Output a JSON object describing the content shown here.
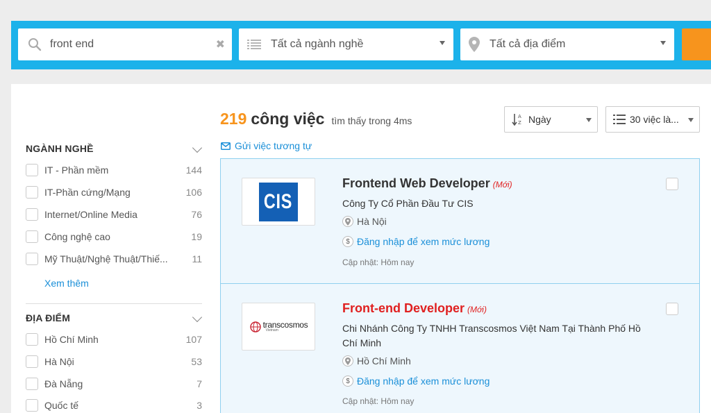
{
  "search": {
    "keyword": "front end",
    "industry": "Tất cả ngành nghề",
    "location": "Tất cả địa điểm"
  },
  "results": {
    "count": "219",
    "count_label": "công việc",
    "time_text": "tìm thấy trong 4ms",
    "subscribe": "Gửi việc tương tự",
    "sort_label": "Ngày",
    "per_page_label": "30 việc là..."
  },
  "filters": {
    "industry": {
      "heading": "NGÀNH NGHỀ",
      "items": [
        {
          "label": "IT - Phần mềm",
          "count": "144"
        },
        {
          "label": "IT-Phần cứng/Mạng",
          "count": "106"
        },
        {
          "label": "Internet/Online Media",
          "count": "76"
        },
        {
          "label": "Công nghệ cao",
          "count": "19"
        },
        {
          "label": "Mỹ Thuật/Nghệ Thuật/Thiế...",
          "count": "11"
        }
      ],
      "more": "Xem thêm"
    },
    "location": {
      "heading": "ĐỊA ĐIỂM",
      "items": [
        {
          "label": "Hồ Chí Minh",
          "count": "107"
        },
        {
          "label": "Hà Nội",
          "count": "53"
        },
        {
          "label": "Đà Nẵng",
          "count": "7"
        },
        {
          "label": "Quốc tế",
          "count": "3"
        }
      ]
    }
  },
  "jobs": [
    {
      "title": "Frontend Web Developer",
      "new_tag": "(Mới)",
      "company": "Công Ty Cổ Phần Đầu Tư CIS",
      "location": "Hà Nội",
      "salary": "Đăng nhập để xem mức lương",
      "updated": "Cập nhật: Hôm nay",
      "logo_text": "CIS"
    },
    {
      "title": "Front-end Developer",
      "new_tag": "(Mới)",
      "company": "Chi Nhánh Công Ty TNHH Transcosmos Việt Nam Tại Thành Phố Hồ Chí Minh",
      "location": "Hồ Chí Minh",
      "salary": "Đăng nhập để xem mức lương",
      "updated": "Cập nhật: Hôm nay",
      "logo_text": "transcosmos",
      "logo_sub": "Vietnam"
    }
  ],
  "icons": {
    "search": "search-icon",
    "list": "list-icon",
    "pin": "map-pin-icon",
    "mail": "mail-icon",
    "sort": "sort-az-icon",
    "per_page": "numbered-list-icon",
    "dollar": "dollar-icon"
  },
  "colors": {
    "band": "#1cb2ea",
    "accent": "#f7941d",
    "link": "#1a8fd8",
    "card_bg": "#eef7fd",
    "card_border": "#8fd0ef",
    "title_highlight": "#e02020"
  }
}
